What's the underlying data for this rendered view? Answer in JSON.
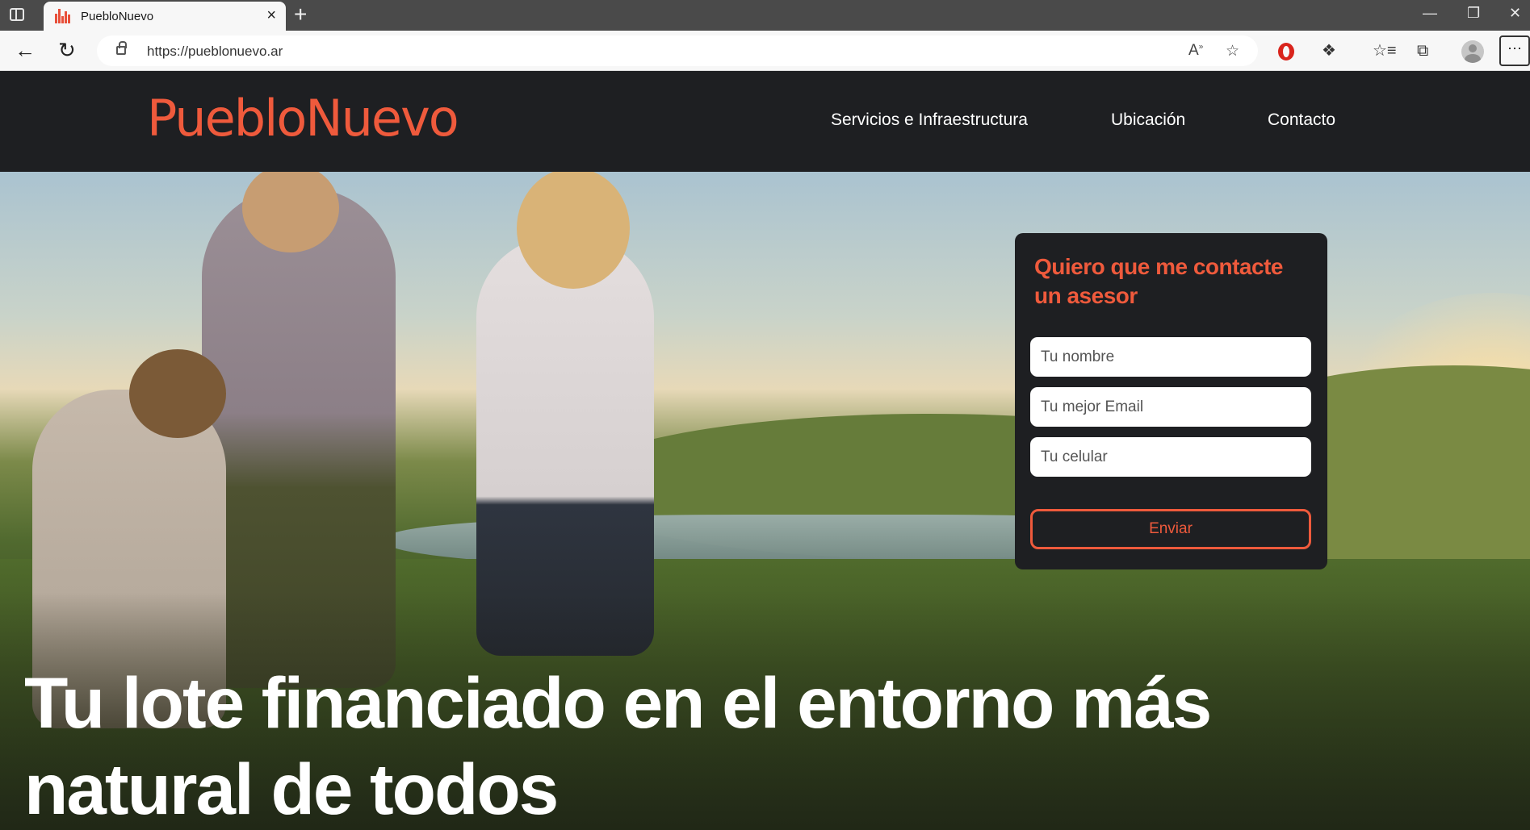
{
  "browser": {
    "tab_title": "PuebloNuevo",
    "tab_close": "×",
    "new_tab": "+",
    "url": "https://pueblonuevo.ar",
    "window_controls": {
      "minimize": "—",
      "restore": "❐",
      "close": "✕"
    },
    "icons": [
      "sidebar-icon",
      "favicon",
      "back-icon",
      "reload-icon",
      "lock-icon",
      "read-aloud-icon",
      "favorite-add-icon",
      "opera-icon",
      "extensions-icon",
      "favorites-icon",
      "collections-icon",
      "profile-icon",
      "more-icon"
    ]
  },
  "header": {
    "logo": "PuebloNuevo",
    "nav": [
      "Servicios e Infraestructura",
      "Ubicación",
      "Contacto"
    ],
    "accent_color": "#ef5a3c",
    "background_color": "#1e1f22"
  },
  "contact_form": {
    "title": "Quiero que me contacte un asesor",
    "name_placeholder": "Tu nombre",
    "email_placeholder": "Tu mejor Email",
    "phone_placeholder": "Tu celular",
    "submit_label": "Enviar"
  },
  "hero": {
    "headline": "Tu lote financiado en el entorno más natural de todos"
  }
}
